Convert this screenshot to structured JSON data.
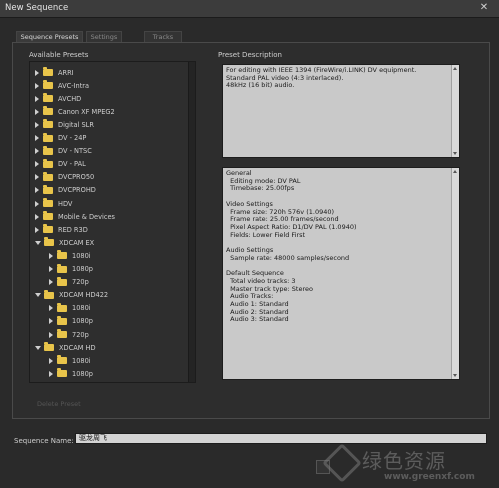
{
  "window": {
    "title": "New Sequence",
    "close_glyph": "✕"
  },
  "tabs": [
    {
      "label": "Sequence Presets"
    },
    {
      "label": "Settings"
    },
    {
      "label": "Tracks"
    }
  ],
  "presets": {
    "heading": "Available Presets",
    "items": [
      {
        "label": "ARRI",
        "expanded": false
      },
      {
        "label": "AVC-Intra",
        "expanded": false
      },
      {
        "label": "AVCHD",
        "expanded": false
      },
      {
        "label": "Canon XF MPEG2",
        "expanded": false
      },
      {
        "label": "Digital SLR",
        "expanded": false
      },
      {
        "label": "DV - 24P",
        "expanded": false
      },
      {
        "label": "DV - NTSC",
        "expanded": false
      },
      {
        "label": "DV - PAL",
        "expanded": false
      },
      {
        "label": "DVCPRO50",
        "expanded": false
      },
      {
        "label": "DVCPROHD",
        "expanded": false
      },
      {
        "label": "HDV",
        "expanded": false
      },
      {
        "label": "Mobile & Devices",
        "expanded": false
      },
      {
        "label": "RED R3D",
        "expanded": false
      },
      {
        "label": "XDCAM EX",
        "expanded": true
      },
      {
        "label": "1080i",
        "expanded": false,
        "child": true
      },
      {
        "label": "1080p",
        "expanded": false,
        "child": true
      },
      {
        "label": "720p",
        "expanded": false,
        "child": true
      },
      {
        "label": "XDCAM HD422",
        "expanded": true
      },
      {
        "label": "1080i",
        "expanded": false,
        "child": true
      },
      {
        "label": "1080p",
        "expanded": false,
        "child": true
      },
      {
        "label": "720p",
        "expanded": false,
        "child": true
      },
      {
        "label": "XDCAM HD",
        "expanded": true
      },
      {
        "label": "1080i",
        "expanded": false,
        "child": true
      },
      {
        "label": "1080p",
        "expanded": false,
        "child": true
      }
    ]
  },
  "description": {
    "heading": "Preset Description",
    "text": "For editing with IEEE 1394 (FireWire/i.LINK) DV equipment.\nStandard PAL video (4:3 interlaced).\n48kHz (16 bit) audio."
  },
  "details": {
    "text": "General\n  Editing mode: DV PAL\n  Timebase: 25.00fps\n\nVideo Settings\n  Frame size: 720h 576v (1.0940)\n  Frame rate: 25.00 frames/second\n  Pixel Aspect Ratio: D1/DV PAL (1.0940)\n  Fields: Lower Field First\n\nAudio Settings\n  Sample rate: 48000 samples/second\n\nDefault Sequence\n  Total video tracks: 3\n  Master track type: Stereo\n  Audio Tracks:\n  Audio 1: Standard\n  Audio 2: Standard\n  Audio 3: Standard"
  },
  "delete_preset_label": "Delete Preset",
  "sequence_name": {
    "label": "Sequence Name:",
    "value": "驱龙周飞"
  },
  "watermark": {
    "text": "绿色资源",
    "url": "www.greenxf.com"
  },
  "colors": {
    "background": "#2a2a2a",
    "folder": "#e8c44a",
    "textbox": "#c9c9c9"
  }
}
